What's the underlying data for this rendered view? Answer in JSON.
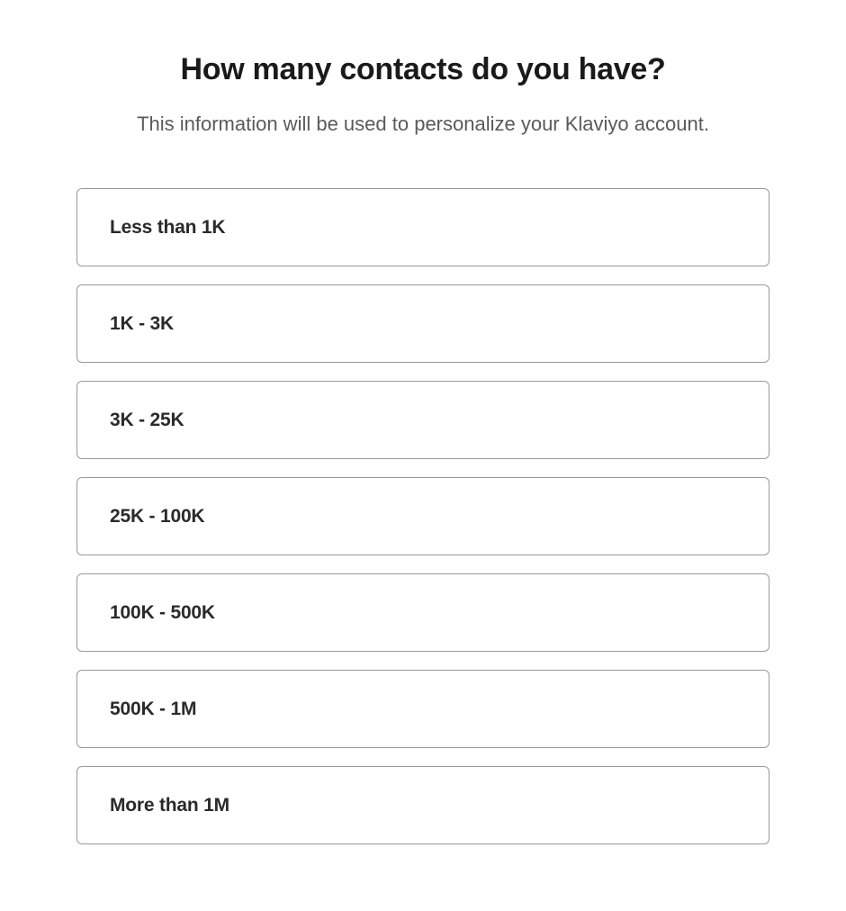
{
  "heading": "How many contacts do you have?",
  "subheading": "This information will be used to personalize your Klaviyo account.",
  "options": [
    {
      "label": "Less than 1K"
    },
    {
      "label": "1K - 3K"
    },
    {
      "label": "3K - 25K"
    },
    {
      "label": "25K - 100K"
    },
    {
      "label": "100K - 500K"
    },
    {
      "label": "500K - 1M"
    },
    {
      "label": "More than 1M"
    }
  ]
}
